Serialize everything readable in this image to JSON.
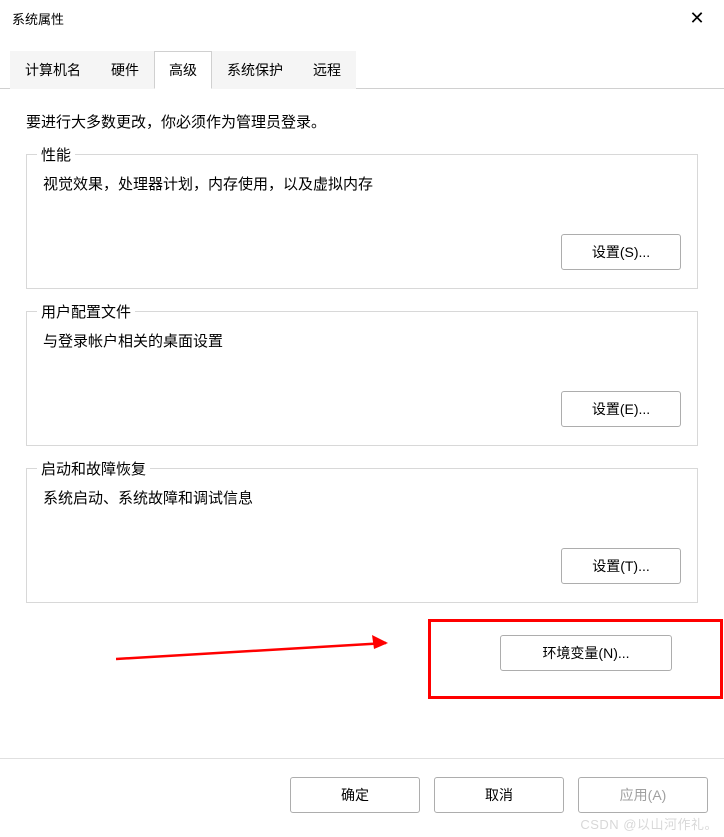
{
  "window": {
    "title": "系统属性",
    "close_icon": "✕"
  },
  "tabs": {
    "items": [
      {
        "label": "计算机名"
      },
      {
        "label": "硬件"
      },
      {
        "label": "高级"
      },
      {
        "label": "系统保护"
      },
      {
        "label": "远程"
      }
    ],
    "active_index": 2
  },
  "content": {
    "intro": "要进行大多数更改，你必须作为管理员登录。",
    "performance": {
      "legend": "性能",
      "desc": "视觉效果，处理器计划，内存使用，以及虚拟内存",
      "button": "设置(S)..."
    },
    "user_profile": {
      "legend": "用户配置文件",
      "desc": "与登录帐户相关的桌面设置",
      "button": "设置(E)..."
    },
    "startup": {
      "legend": "启动和故障恢复",
      "desc": "系统启动、系统故障和调试信息",
      "button": "设置(T)..."
    },
    "env_var_button": "环境变量(N)..."
  },
  "bottom_buttons": {
    "ok": "确定",
    "cancel": "取消",
    "apply": "应用(A)"
  },
  "watermark": "CSDN @以山河作礼。"
}
